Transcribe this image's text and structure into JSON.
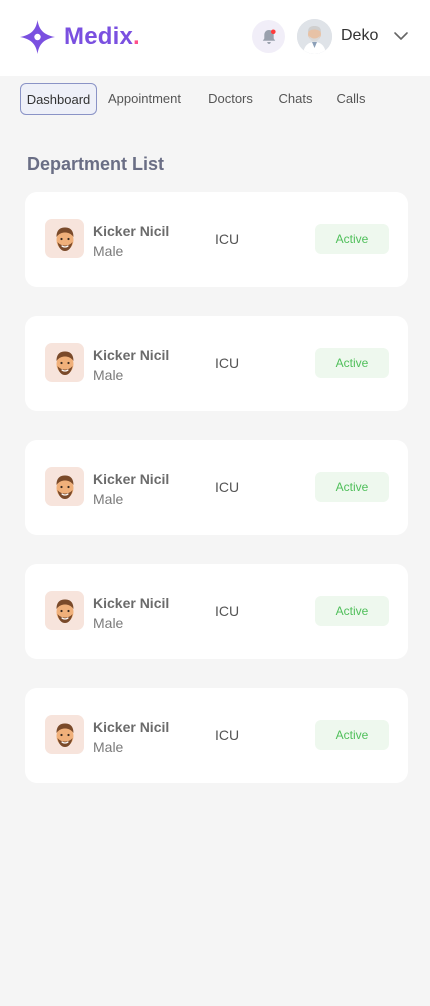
{
  "brand": {
    "name": "Medix",
    "dot": ".",
    "colors": {
      "primary": "#7a50e0",
      "accent": "#ff4f8b"
    }
  },
  "user": {
    "name": "Deko"
  },
  "nav": {
    "tabs": [
      {
        "label": "Dashboard",
        "active": true
      },
      {
        "label": "Appointment",
        "active": false
      },
      {
        "label": "Doctors",
        "active": false
      },
      {
        "label": "Chats",
        "active": false
      },
      {
        "label": "Calls",
        "active": false
      }
    ]
  },
  "department": {
    "title": "Department List",
    "rows": [
      {
        "name": "Kicker Nicil",
        "gender": "Male",
        "dept": "ICU",
        "status": "Active"
      },
      {
        "name": "Kicker Nicil",
        "gender": "Male",
        "dept": "ICU",
        "status": "Active"
      },
      {
        "name": "Kicker Nicil",
        "gender": "Male",
        "dept": "ICU",
        "status": "Active"
      },
      {
        "name": "Kicker Nicil",
        "gender": "Male",
        "dept": "ICU",
        "status": "Active"
      },
      {
        "name": "Kicker Nicil",
        "gender": "Male",
        "dept": "ICU",
        "status": "Active"
      }
    ]
  },
  "status_colors": {
    "active_text": "#4fbf5a",
    "active_bg": "#eef8ee"
  }
}
